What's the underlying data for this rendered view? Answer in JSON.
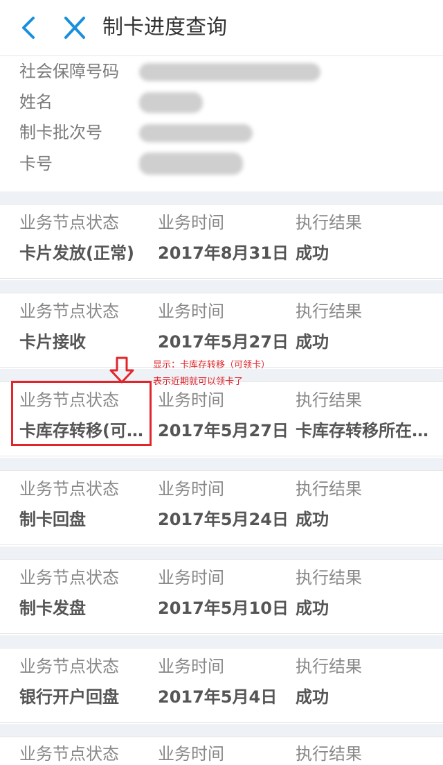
{
  "header": {
    "title": "制卡进度查询"
  },
  "info": {
    "labels": [
      "社会保障号码",
      "姓名",
      "制卡批次号",
      "卡号"
    ]
  },
  "records": [
    {
      "status_label": "业务节点状态",
      "time_label": "业务时间",
      "result_label": "执行结果",
      "status": "卡片发放(正常)",
      "time": "2017年8月31日",
      "result": "成功"
    },
    {
      "status_label": "业务节点状态",
      "time_label": "业务时间",
      "result_label": "执行结果",
      "status": "卡片接收",
      "time": "2017年5月27日",
      "result": "成功"
    },
    {
      "status_label": "业务节点状态",
      "time_label": "业务时间",
      "result_label": "执行结果",
      "status": "卡库存转移(可…",
      "time": "2017年5月27日",
      "result": "卡库存转移所在…"
    },
    {
      "status_label": "业务节点状态",
      "time_label": "业务时间",
      "result_label": "执行结果",
      "status": "制卡回盘",
      "time": "2017年5月24日",
      "result": "成功"
    },
    {
      "status_label": "业务节点状态",
      "time_label": "业务时间",
      "result_label": "执行结果",
      "status": "制卡发盘",
      "time": "2017年5月10日",
      "result": "成功"
    },
    {
      "status_label": "业务节点状态",
      "time_label": "业务时间",
      "result_label": "执行结果",
      "status": "银行开户回盘",
      "time": "2017年5月4日",
      "result": "成功"
    },
    {
      "status_label": "业务节点状态",
      "time_label": "业务时间",
      "result_label": "执行结果"
    }
  ],
  "annotation": {
    "line1": "显示：卡库存转移（可领卡）",
    "line2": "表示近期就可以领卡了"
  },
  "colors": {
    "accent": "#1a8fdc",
    "annotation": "#e0262b",
    "section_gap": "#eef1f5"
  },
  "icons": {
    "back": "chevron-left-icon",
    "close": "close-icon",
    "annotation_arrow": "down-arrow-icon"
  }
}
